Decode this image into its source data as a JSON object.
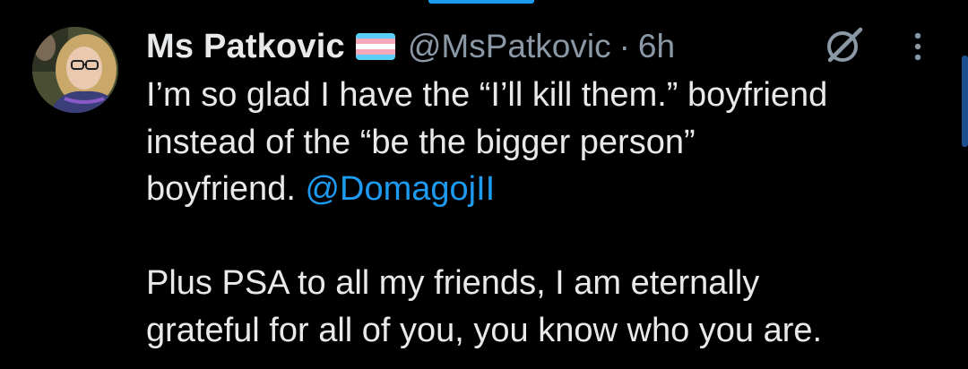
{
  "tweet": {
    "display_name": "Ms Patkovic",
    "handle": "@MsPatkovic",
    "separator": "·",
    "time": "6h",
    "flag_colors": [
      "#5bcefa",
      "#f5a9b8",
      "#ffffff",
      "#f5a9b8",
      "#5bcefa"
    ],
    "body_part1": "I’m so glad I have the “I’ll kill them.” boyfriend\ninstead of the “be the bigger person”\nboyfriend. ",
    "mention": "@DomagojII",
    "body_part2": "\n\nPlus PSA to all my friends, I am eternally\ngrateful for all of you, you know who you are."
  },
  "icons": {
    "grok": "grok-icon",
    "more": "more-options-icon",
    "flag": "transgender-flag-icon"
  },
  "colors": {
    "background": "#000000",
    "text": "#e7e9ea",
    "secondary": "#8b98a5",
    "link": "#1d9bf0"
  }
}
